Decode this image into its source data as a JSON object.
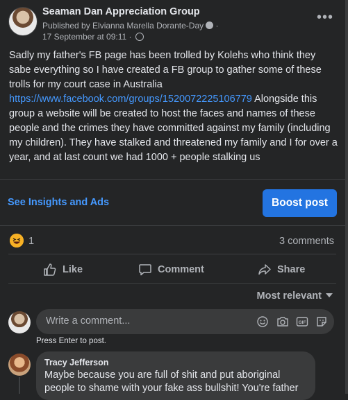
{
  "post": {
    "group_name": "Seaman Dan Appreciation Group",
    "published_by": "Published by Elvianna Marella Dorante-Day",
    "timestamp": "17 September at 09:11",
    "body_before_link": "Sadly my father's FB page has been trolled by Kolehs who think they sabe everything so I have created a FB group to gather some of these trolls for my court case in Australia",
    "link": "https://www.facebook.com/groups/1520072225106779",
    "body_after_link": " Alongside this group a website will be created to host the faces and names of these people and the crimes they have committed against my family (including my children).  They have stalked and threatened my family and I for over a year, and at last count we had 1000 + people stalking us"
  },
  "promo": {
    "insights_label": "See Insights and Ads",
    "boost_label": "Boost post"
  },
  "stats": {
    "reaction_icon": "laughing-emoji-icon",
    "reaction_count": "1",
    "comments_count": "3 comments"
  },
  "actions": {
    "like": "Like",
    "comment": "Comment",
    "share": "Share"
  },
  "sort": {
    "label": "Most relevant"
  },
  "composer": {
    "placeholder": "Write a comment...",
    "hint": "Press Enter to post.",
    "icons": [
      "smiley-icon",
      "camera-icon",
      "gif-icon",
      "sticker-icon"
    ]
  },
  "comments": [
    {
      "author": "Tracy Jefferson",
      "text": "Maybe because you are full of shit and put aboriginal people to shame with your fake ass bullshit! You're father"
    }
  ],
  "colors": {
    "background": "#242526",
    "accent": "#2374e1",
    "link": "#4599ff",
    "text_secondary": "#b0b3b8"
  }
}
